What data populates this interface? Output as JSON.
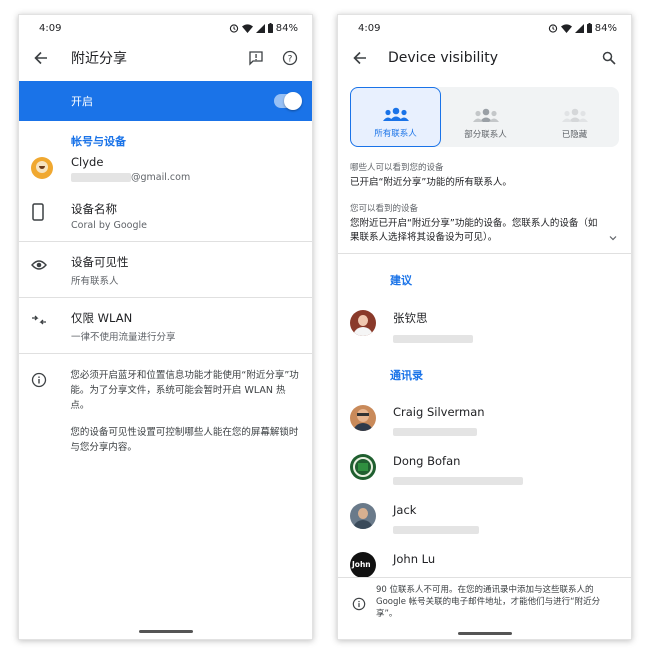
{
  "left": {
    "status": {
      "time": "4:09",
      "battery": "84%"
    },
    "header": {
      "title": "附近分享"
    },
    "toggle": {
      "label": "开启",
      "on": true
    },
    "section_title": "帐号与设备",
    "account": {
      "name": "Clyde",
      "email_suffix": "@gmail.com"
    },
    "device_name": {
      "title": "设备名称",
      "value": "Coral by Google"
    },
    "visibility": {
      "title": "设备可见性",
      "value": "所有联系人"
    },
    "wlan": {
      "title": "仅限 WLAN",
      "value": "一律不使用流量进行分享"
    },
    "info": {
      "p1": "您必须开启蓝牙和位置信息功能才能使用“附近分享”功能。为了分享文件，系统可能会暂时开启 WLAN 热点。",
      "p2": "您的设备可见性设置可控制哪些人能在您的屏幕解锁时与您分享内容。"
    }
  },
  "right": {
    "status": {
      "time": "4:09",
      "battery": "84%"
    },
    "header": {
      "title": "Device visibility"
    },
    "options": [
      {
        "label": "所有联系人",
        "selected": true
      },
      {
        "label": "部分联系人",
        "selected": false
      },
      {
        "label": "已隐藏",
        "selected": false
      }
    ],
    "who_sees": {
      "heading": "哪些人可以看到您的设备",
      "body": "已开启“附近分享”功能的所有联系人。"
    },
    "you_see": {
      "heading": "您可以看到的设备",
      "body": "您附近已开启“附近分享”功能的设备。您联系人的设备（如果联系人选择将其设备设为可见）。"
    },
    "suggested_title": "建议",
    "suggested": [
      {
        "name": "张钦思"
      }
    ],
    "contacts_title": "通讯录",
    "contacts": [
      {
        "name": "Craig Silverman"
      },
      {
        "name": "Dong Bofan"
      },
      {
        "name": "Jack"
      },
      {
        "name": "John Lu"
      }
    ],
    "footer": "90 位联系人不可用。在您的通讯录中添加与这些联系人的 Google 帐号关联的电子邮件地址，才能他们与进行“附近分享”。"
  },
  "colors": {
    "accent": "#1a73e8",
    "selected_bg": "#e8f0fe",
    "panel_bg": "#f1f3f4"
  }
}
